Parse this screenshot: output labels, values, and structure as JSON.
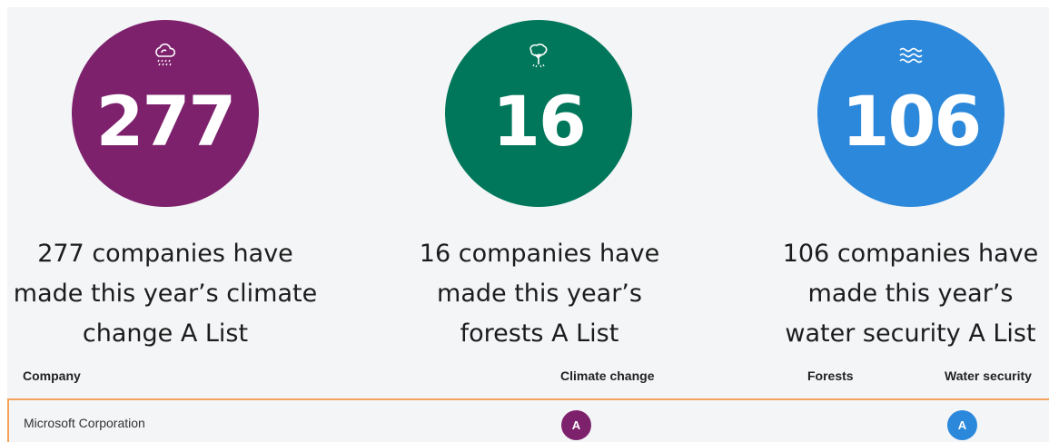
{
  "stats": [
    {
      "number": "277",
      "caption_lines": [
        "277 companies have",
        "made this year’s climate",
        "change A List"
      ],
      "color": "#7e216d",
      "icon": "cloud-rain-icon"
    },
    {
      "number": "16",
      "caption_lines": [
        "16 companies have",
        "made this year’s",
        "forests A List"
      ],
      "color": "#00775a",
      "icon": "tree-icon"
    },
    {
      "number": "106",
      "caption_lines": [
        "106 companies have",
        "made this year’s",
        "water security A List"
      ],
      "color": "#2b88db",
      "icon": "waves-icon"
    }
  ],
  "table": {
    "headers": {
      "company": "Company",
      "climate": "Climate change",
      "forests": "Forests",
      "water": "Water security"
    },
    "rows": [
      {
        "company": "Microsoft Corporation",
        "climate": "A",
        "forests": "",
        "water": "A"
      }
    ]
  },
  "colors": {
    "highlight_border": "#f5a25a"
  }
}
